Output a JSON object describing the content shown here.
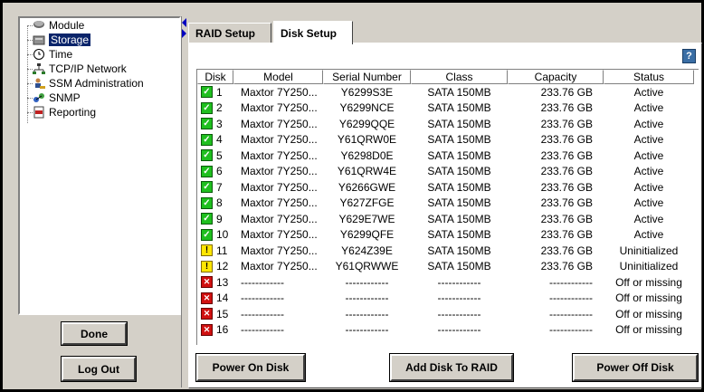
{
  "tree": {
    "items": [
      {
        "label": "Module",
        "icon": "module-icon",
        "selected": false
      },
      {
        "label": "Storage",
        "icon": "storage-icon",
        "selected": true
      },
      {
        "label": "Time",
        "icon": "clock-icon",
        "selected": false
      },
      {
        "label": "TCP/IP Network",
        "icon": "network-icon",
        "selected": false
      },
      {
        "label": "SSM Administration",
        "icon": "admin-icon",
        "selected": false
      },
      {
        "label": "SNMP",
        "icon": "snmp-icon",
        "selected": false
      },
      {
        "label": "Reporting",
        "icon": "reporting-icon",
        "selected": false
      }
    ]
  },
  "left_buttons": {
    "done": "Done",
    "logout": "Log Out"
  },
  "tabs": [
    {
      "label": "RAID Setup",
      "active": false
    },
    {
      "label": "Disk Setup",
      "active": true
    }
  ],
  "help": "?",
  "table": {
    "headers": [
      "Disk",
      "Model",
      "Serial Number",
      "Class",
      "Capacity",
      "Status"
    ],
    "rows": [
      {
        "state": "ok",
        "disk": "1",
        "model": "Maxtor 7Y250...",
        "serial": "Y6299S3E",
        "class": "SATA 150MB",
        "capacity": "233.76 GB",
        "status": "Active"
      },
      {
        "state": "ok",
        "disk": "2",
        "model": "Maxtor 7Y250...",
        "serial": "Y6299NCE",
        "class": "SATA 150MB",
        "capacity": "233.76 GB",
        "status": "Active"
      },
      {
        "state": "ok",
        "disk": "3",
        "model": "Maxtor 7Y250...",
        "serial": "Y6299QQE",
        "class": "SATA 150MB",
        "capacity": "233.76 GB",
        "status": "Active"
      },
      {
        "state": "ok",
        "disk": "4",
        "model": "Maxtor 7Y250...",
        "serial": "Y61QRW0E",
        "class": "SATA 150MB",
        "capacity": "233.76 GB",
        "status": "Active"
      },
      {
        "state": "ok",
        "disk": "5",
        "model": "Maxtor 7Y250...",
        "serial": "Y6298D0E",
        "class": "SATA 150MB",
        "capacity": "233.76 GB",
        "status": "Active"
      },
      {
        "state": "ok",
        "disk": "6",
        "model": "Maxtor 7Y250...",
        "serial": "Y61QRW4E",
        "class": "SATA 150MB",
        "capacity": "233.76 GB",
        "status": "Active"
      },
      {
        "state": "ok",
        "disk": "7",
        "model": "Maxtor 7Y250...",
        "serial": "Y6266GWE",
        "class": "SATA 150MB",
        "capacity": "233.76 GB",
        "status": "Active"
      },
      {
        "state": "ok",
        "disk": "8",
        "model": "Maxtor 7Y250...",
        "serial": "Y627ZFGE",
        "class": "SATA 150MB",
        "capacity": "233.76 GB",
        "status": "Active"
      },
      {
        "state": "ok",
        "disk": "9",
        "model": "Maxtor 7Y250...",
        "serial": "Y629E7WE",
        "class": "SATA 150MB",
        "capacity": "233.76 GB",
        "status": "Active"
      },
      {
        "state": "ok",
        "disk": "10",
        "model": "Maxtor 7Y250...",
        "serial": "Y6299QFE",
        "class": "SATA 150MB",
        "capacity": "233.76 GB",
        "status": "Active"
      },
      {
        "state": "warn",
        "disk": "11",
        "model": "Maxtor 7Y250...",
        "serial": "Y624Z39E",
        "class": "SATA 150MB",
        "capacity": "233.76 GB",
        "status": "Uninitialized"
      },
      {
        "state": "warn",
        "disk": "12",
        "model": "Maxtor 7Y250...",
        "serial": "Y61QRWWE",
        "class": "SATA 150MB",
        "capacity": "233.76 GB",
        "status": "Uninitialized"
      },
      {
        "state": "err",
        "disk": "13",
        "model": "------------",
        "serial": "------------",
        "class": "------------",
        "capacity": "------------",
        "status": "Off or missing"
      },
      {
        "state": "err",
        "disk": "14",
        "model": "------------",
        "serial": "------------",
        "class": "------------",
        "capacity": "------------",
        "status": "Off or missing"
      },
      {
        "state": "err",
        "disk": "15",
        "model": "------------",
        "serial": "------------",
        "class": "------------",
        "capacity": "------------",
        "status": "Off or missing"
      },
      {
        "state": "err",
        "disk": "16",
        "model": "------------",
        "serial": "------------",
        "class": "------------",
        "capacity": "------------",
        "status": "Off or missing"
      }
    ]
  },
  "actions": {
    "power_on": "Power On Disk",
    "add_raid": "Add Disk To RAID",
    "power_off": "Power Off Disk"
  },
  "colors": {
    "ok": "#1fbf1f",
    "warn": "#ffe600",
    "err": "#d01010",
    "selection": "#0a246a"
  }
}
